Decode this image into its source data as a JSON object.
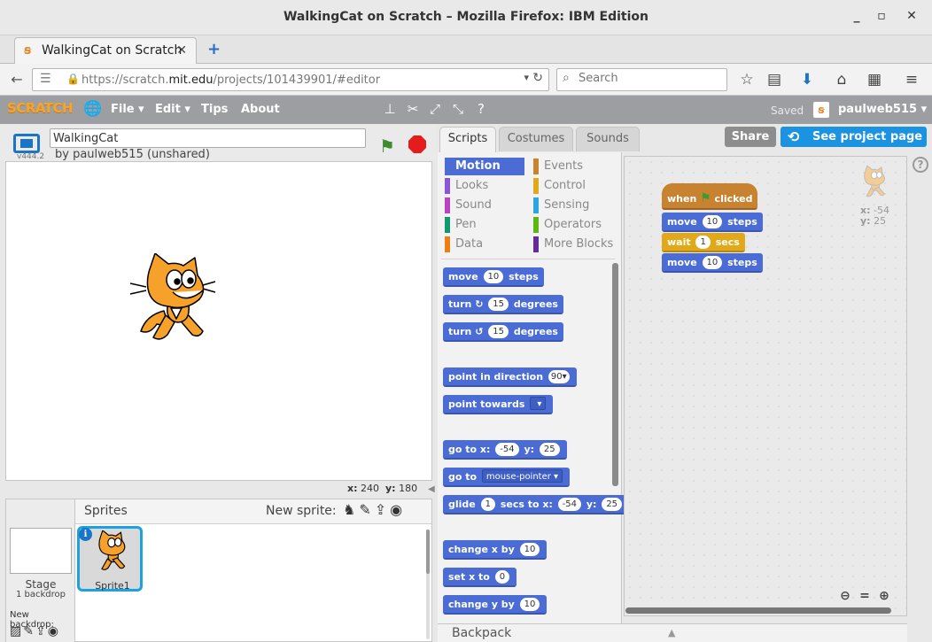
{
  "window": {
    "title": "WalkingCat on Scratch – Mozilla Firefox: IBM Edition"
  },
  "browser_tab": {
    "label": "WalkingCat on Scratch"
  },
  "address": {
    "url_prefix": "https://scratch.",
    "url_host": "mit.edu",
    "url_suffix": "/projects/101439901/#editor"
  },
  "search": {
    "placeholder": "Search"
  },
  "scratch_menu": {
    "logo": "SCRATCH",
    "items": [
      "File ▾",
      "Edit ▾",
      "Tips",
      "About"
    ],
    "saved": "Saved",
    "user": "paulweb515 ▾"
  },
  "stage": {
    "version": "v444.2",
    "project_title": "WalkingCat",
    "byline": "by paulweb515 (unshared)",
    "coords": {
      "x_label": "x:",
      "x": "240",
      "y_label": "y:",
      "y": "180"
    }
  },
  "sprites_pane": {
    "title": "Sprites",
    "new_sprite": "New sprite:",
    "stage_label": "Stage",
    "backdrops": "1 backdrop",
    "new_backdrop": "New backdrop:",
    "sprites": [
      {
        "name": "Sprite1"
      }
    ]
  },
  "editor_tabs": [
    "Scripts",
    "Costumes",
    "Sounds"
  ],
  "buttons": {
    "share": "Share",
    "project_page": "See project page"
  },
  "categories": [
    {
      "label": "Motion",
      "color": "#4a6cd4",
      "active": true
    },
    {
      "label": "Events",
      "color": "#c88330"
    },
    {
      "label": "Looks",
      "color": "#8a55d7"
    },
    {
      "label": "Control",
      "color": "#e1a91a"
    },
    {
      "label": "Sound",
      "color": "#bb42c3"
    },
    {
      "label": "Sensing",
      "color": "#2ca5e2"
    },
    {
      "label": "Pen",
      "color": "#0e9a6c"
    },
    {
      "label": "Operators",
      "color": "#5cb712"
    },
    {
      "label": "Data",
      "color": "#ee7d16"
    },
    {
      "label": "More Blocks",
      "color": "#632d99"
    }
  ],
  "palette_blocks": {
    "move": {
      "a": "move",
      "n": "10",
      "b": "steps"
    },
    "turn_cw": {
      "a": "turn",
      "n": "15",
      "b": "degrees"
    },
    "turn_ccw": {
      "a": "turn",
      "n": "15",
      "b": "degrees"
    },
    "point_dir": {
      "a": "point in direction",
      "n": "90▾"
    },
    "point_towards": {
      "a": "point towards"
    },
    "goto_xy": {
      "a": "go to x:",
      "x": "-54",
      "b": "y:",
      "y": "25"
    },
    "goto": {
      "a": "go to",
      "d": "mouse-pointer ▾"
    },
    "glide": {
      "a": "glide",
      "n": "1",
      "b": "secs to x:",
      "x": "-54",
      "c": "y:",
      "y": "25"
    },
    "change_x": {
      "a": "change x by",
      "n": "10"
    },
    "set_x": {
      "a": "set x to",
      "n": "0"
    },
    "change_y": {
      "a": "change y by",
      "n": "10"
    }
  },
  "script": {
    "hat": {
      "a": "when",
      "b": "clicked"
    },
    "move1": {
      "a": "move",
      "n": "10",
      "b": "steps"
    },
    "wait": {
      "a": "wait",
      "n": "1",
      "b": "secs"
    },
    "move2": {
      "a": "move",
      "n": "10",
      "b": "steps"
    }
  },
  "sprite_info": {
    "x_label": "x:",
    "x": "-54",
    "y_label": "y:",
    "y": "25"
  },
  "backpack": {
    "label": "Backpack"
  },
  "colors": {
    "motion": "#4a6cd4",
    "control": "#e1a91a",
    "events": "#c88330",
    "accent": "#1b93e0"
  }
}
